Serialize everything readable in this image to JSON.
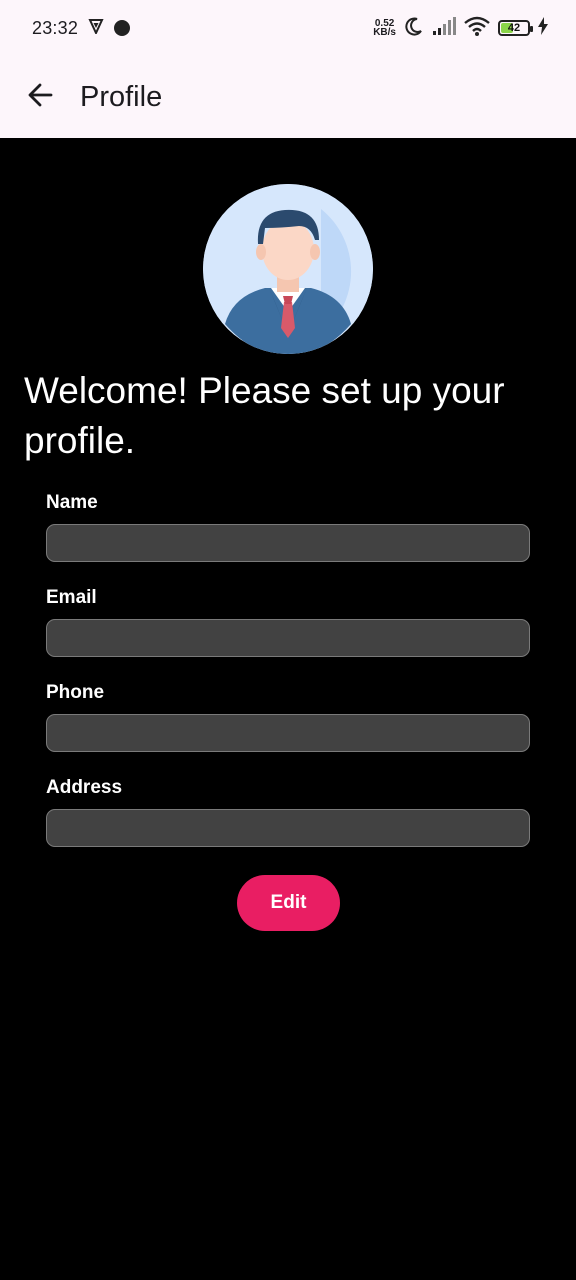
{
  "status_bar": {
    "time": "23:32",
    "net_speed_value": "0.52",
    "net_speed_unit": "KB/s",
    "battery_level": "42",
    "icons": [
      "vpn-shield-icon",
      "notification-dot-icon",
      "moon-icon",
      "signal-icon",
      "wifi-icon",
      "battery-icon",
      "charging-bolt-icon"
    ]
  },
  "app_bar": {
    "title": "Profile",
    "back_icon": "arrow-back-icon"
  },
  "main": {
    "avatar_icon": "businessman-avatar-icon",
    "welcome_text": "Welcome! Please set up your profile.",
    "fields": [
      {
        "label": "Name",
        "value": "",
        "placeholder": ""
      },
      {
        "label": "Email",
        "value": "",
        "placeholder": ""
      },
      {
        "label": "Phone",
        "value": "",
        "placeholder": ""
      },
      {
        "label": "Address",
        "value": "",
        "placeholder": ""
      }
    ],
    "edit_button_label": "Edit"
  },
  "colors": {
    "app_bar_bg": "#fdf6fb",
    "content_bg": "#000000",
    "input_bg": "#424242",
    "accent": "#e91e63"
  }
}
